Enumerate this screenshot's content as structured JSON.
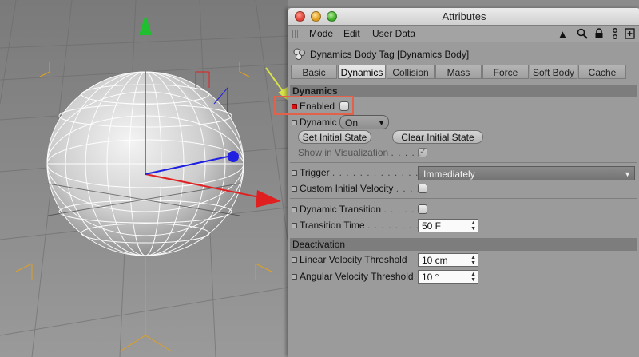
{
  "window": {
    "title": "Attributes"
  },
  "menubar": {
    "items": [
      "Mode",
      "Edit",
      "User Data"
    ]
  },
  "header": {
    "object_label": "Dynamics Body Tag [Dynamics Body]"
  },
  "tabs": [
    {
      "label": "Basic",
      "active": false
    },
    {
      "label": "Dynamics",
      "active": true
    },
    {
      "label": "Collision",
      "active": false
    },
    {
      "label": "Mass",
      "active": false
    },
    {
      "label": "Force",
      "active": false
    },
    {
      "label": "Soft Body",
      "active": false
    },
    {
      "label": "Cache",
      "active": false
    }
  ],
  "dynamics": {
    "section_title": "Dynamics",
    "enabled": {
      "label": "Enabled",
      "checked": false
    },
    "dynamic": {
      "label": "Dynamic",
      "value": "On"
    },
    "set_initial_state": "Set Initial State",
    "clear_initial_state": "Clear Initial State",
    "show_in_visualization": {
      "label": "Show in Visualization",
      "dots": ". . . . .",
      "checked": true
    },
    "trigger": {
      "label": "Trigger",
      "dots": ". . . . . . . . . . . . . . .",
      "value": "Immediately"
    },
    "custom_initial_velocity": {
      "label": "Custom Initial Velocity",
      "dots": ". . . .",
      "checked": false
    },
    "dynamic_transition": {
      "label": "Dynamic Transition",
      "dots": ". . . . . .",
      "checked": false
    },
    "transition_time": {
      "label": "Transition Time",
      "dots": ". . . . . . . . .",
      "value": "50 F"
    }
  },
  "deactivation": {
    "section_title": "Deactivation",
    "linear_velocity_threshold": {
      "label": "Linear Velocity Threshold",
      "value": "10 cm"
    },
    "angular_velocity_threshold": {
      "label": "Angular Velocity Threshold",
      "value": "10 °"
    }
  },
  "colors": {
    "annotation_box": "#e3614a",
    "annotation_arrow": "#d7e24a",
    "axis_x": "#e02020",
    "axis_y": "#1fbf2f",
    "axis_z": "#2020e0",
    "panel_bg": "#9b9b9b",
    "section_bg": "#7d7d7d"
  },
  "icons": [
    "grip-icon",
    "cursor-arrow-icon",
    "search-icon",
    "lock-icon",
    "hierarchy-icon",
    "new-panel-icon",
    "dynamics-tag-icon",
    "key-dot-icon"
  ]
}
